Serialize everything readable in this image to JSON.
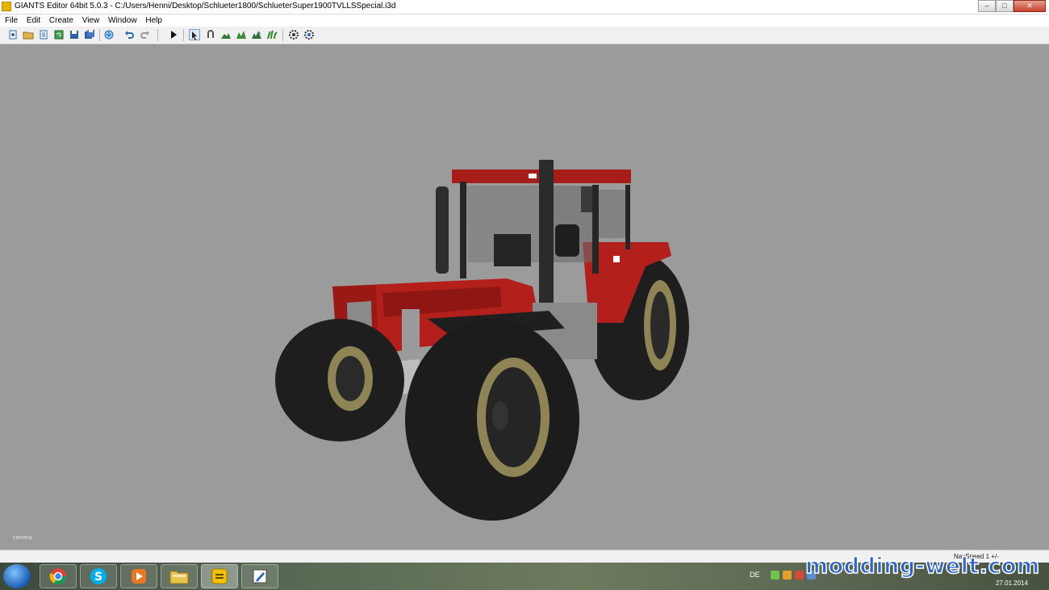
{
  "window": {
    "title": "GIANTS Editor 64bit 5.0.3 - C:/Users/Henni/Desktop/Schlueter1800/SchlueterSuper1900TVLLSSpecial.i3d",
    "buttons": [
      "minimize-icon",
      "maximize-icon",
      "close-icon"
    ]
  },
  "menu": {
    "items": [
      "File",
      "Edit",
      "Create",
      "View",
      "Window",
      "Help"
    ]
  },
  "toolbar": {
    "icons": [
      "new-icon",
      "open-icon",
      "import-icon",
      "reload-icon",
      "save-icon",
      "save-all-icon",
      "export-icon",
      "undo-icon",
      "redo-icon",
      "play-icon",
      "select-icon",
      "move-icon",
      "terrain-sculpt-icon",
      "terrain-paint-icon",
      "foliage-paint-icon",
      "grass-icon",
      "filter-icon",
      "settings-icon"
    ]
  },
  "viewport": {
    "camera_label": "camera",
    "background": "#9b9b9b"
  },
  "statusbar": {
    "nav_speed": "NavSpeed 1 +/-"
  },
  "taskbar": {
    "lang": "DE",
    "date": "27.01.2014",
    "apps": [
      "chrome-icon",
      "skype-icon",
      "media-player-icon",
      "file-explorer-icon",
      "giants-editor-icon",
      "paint-icon"
    ]
  },
  "watermark": "modding-welt.com",
  "colors": {
    "tractor_red": "#b3201c",
    "tire": "#1e1e1e",
    "rim": "#8f8455",
    "taskbar_accent": "#2f66c9"
  }
}
